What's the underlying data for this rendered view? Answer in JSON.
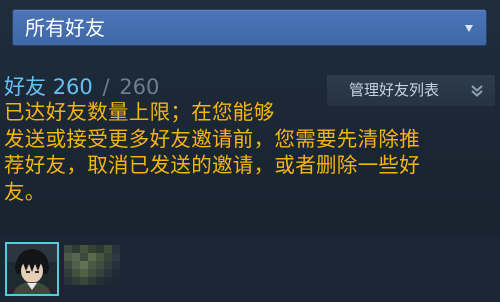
{
  "filter_dropdown": {
    "selected": "所有好友"
  },
  "friends": {
    "label": "好友",
    "count": "260",
    "separator": "/",
    "max": "260"
  },
  "manage_button": {
    "label": "管理好友列表"
  },
  "warning": {
    "lines": [
      "已达好友数量上限；在您能够",
      "发送或接受更多好友邀请前，您需要先清除推",
      "荐好友，取消已发送的邀请，或者删除一些好",
      "友。"
    ]
  },
  "colors": {
    "accent_blue": "#66c0f4",
    "warning_yellow": "#f5b50f",
    "dropdown_blue": "#4570b0",
    "avatar_border": "#57cbde"
  }
}
